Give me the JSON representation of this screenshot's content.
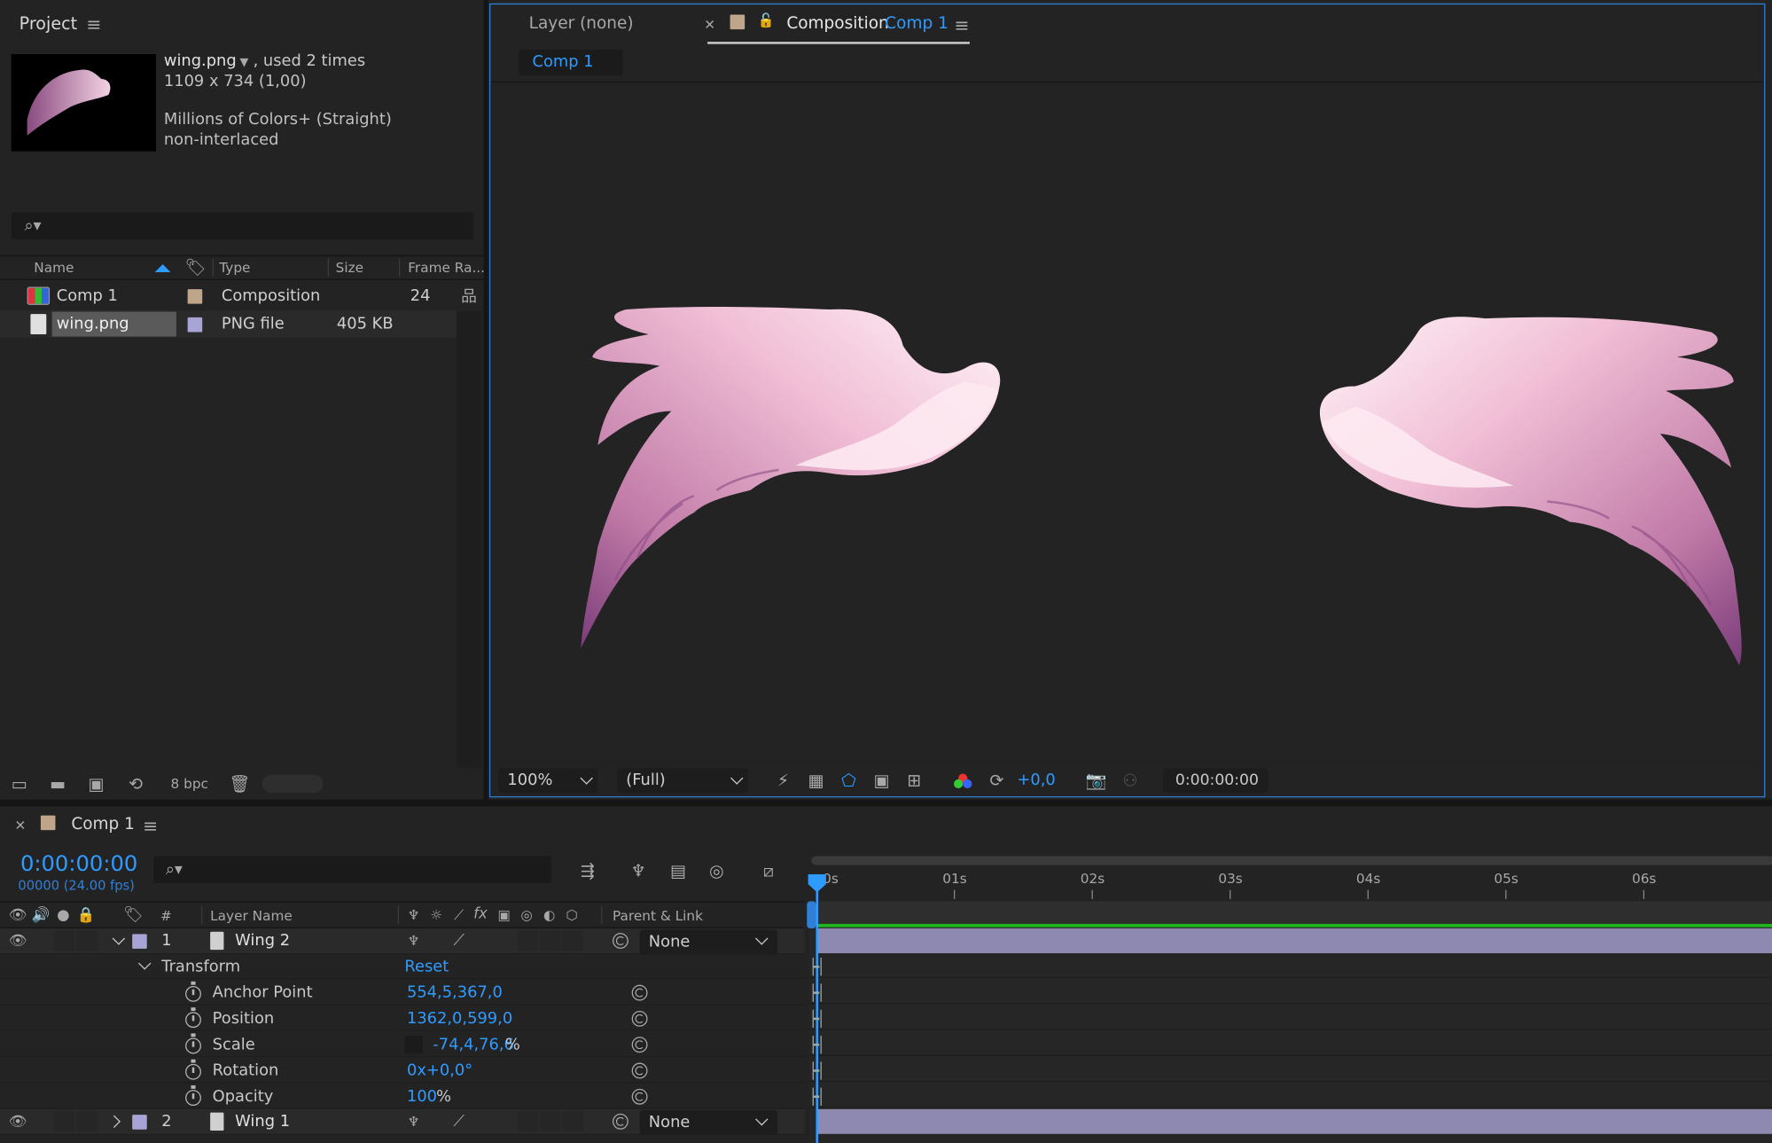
{
  "project": {
    "title": "Project",
    "asset": {
      "name": "wing.png",
      "used": ", used 2 times",
      "dims": "1109 x 734 (1,00)",
      "colors": "Millions of Colors+ (Straight)",
      "interlace": "non-interlaced"
    },
    "search_placeholder": "",
    "columns": {
      "name": "Name",
      "type": "Type",
      "size": "Size",
      "frame_rate": "Frame Ra..."
    },
    "items": [
      {
        "name": "Comp 1",
        "type": "Composition",
        "size": "",
        "frame_rate": "24",
        "label_color": "#bfa58a"
      },
      {
        "name": "wing.png",
        "type": "PNG file",
        "size": "405 KB",
        "frame_rate": "",
        "label_color": "#a9a4d6"
      }
    ],
    "bpc": "8 bpc"
  },
  "viewer": {
    "tab_layer": "Layer (none)",
    "tab_comp_prefix": "Composition",
    "tab_comp_name": "Comp 1",
    "sub_tab": "Comp 1",
    "zoom": "100%",
    "resolution": "(Full)",
    "exposure": "+0,0",
    "timecode": "0:00:00:00"
  },
  "timeline": {
    "tab": "Comp 1",
    "timecode": "0:00:00:00",
    "frames": "00000 (24.00 fps)",
    "ruler": [
      "0s",
      "01s",
      "02s",
      "03s",
      "04s",
      "05s",
      "06s"
    ],
    "columns": {
      "num": "#",
      "layer_name": "Layer Name",
      "parent": "Parent & Link"
    },
    "layers": [
      {
        "index": "1",
        "name": "Wing 2",
        "parent": "None"
      },
      {
        "index": "2",
        "name": "Wing 1",
        "parent": "None"
      }
    ],
    "transform": {
      "label": "Transform",
      "reset": "Reset",
      "props": [
        {
          "name": "Anchor Point",
          "value": "554,5,367,0"
        },
        {
          "name": "Position",
          "value": "1362,0,599,0"
        },
        {
          "name": "Scale",
          "value": "-74,4,76,6",
          "suffix": "%"
        },
        {
          "name": "Rotation",
          "value": "0x+0,0°"
        },
        {
          "name": "Opacity",
          "value": "100",
          "suffix": "%"
        }
      ]
    },
    "colors": {
      "accent": "#2f9bff",
      "layer_bar": "#8e89b0",
      "work_area": "#1fb61f"
    }
  }
}
